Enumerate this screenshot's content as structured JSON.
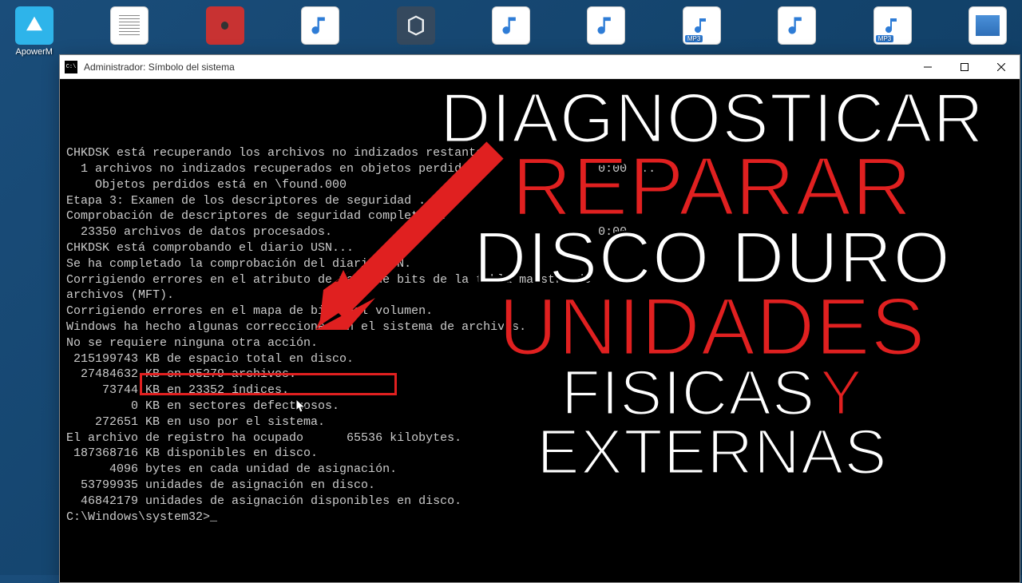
{
  "desktop": {
    "icons": [
      {
        "label": "ApowerM",
        "type": "app"
      },
      {
        "label": "",
        "type": "doc"
      },
      {
        "label": "",
        "type": "media"
      },
      {
        "label": "",
        "type": "audio"
      },
      {
        "label": "",
        "type": "vbox"
      },
      {
        "label": "",
        "type": "audio"
      },
      {
        "label": "",
        "type": "audio"
      },
      {
        "label": "MP3",
        "type": "mp3"
      },
      {
        "label": "",
        "type": "audio"
      },
      {
        "label": "MP3",
        "type": "mp3"
      },
      {
        "label": "",
        "type": "video"
      }
    ]
  },
  "window": {
    "title": "Administrador: Símbolo del sistema"
  },
  "terminal": {
    "lines": [
      "CHKDSK está recuperando los archivos no indizados restantes.",
      "  1 archivos no indizados recuperados en objetos perdidos.                0:00 ...",
      "    Objetos perdidos está en \\found.000",
      "",
      "",
      "Etapa 3: Examen de los descriptores de seguridad ...",
      "Comprobación de descriptores de seguridad completada.",
      "  23350 archivos de datos procesados.                                     0:00",
      "CHKDSK está comprobando el diario USN...",
      "Se ha completado la comprobación del diario USN.",
      "Corrigiendo errores en el atributo de mapa de bits de la tabla maestra de",
      "archivos (MFT).",
      "Corrigiendo errores en el mapa de bits del volumen.",
      "",
      "Windows ha hecho algunas correcciones en el sistema de archivos.",
      "No se requiere ninguna otra acción.",
      "",
      " 215199743 KB de espacio total en disco.",
      "  27484632 KB en 95279 archivos.",
      "     73744 KB en 23352 índices.",
      "         0 KB en sectores defectuosos.",
      "    272651 KB en uso por el sistema.",
      "El archivo de registro ha ocupado      65536 kilobytes.",
      " 187368716 KB disponibles en disco.",
      "",
      "      4096 bytes en cada unidad de asignación.",
      "  53799935 unidades de asignación en disco.",
      "  46842179 unidades de asignación disponibles en disco.",
      "",
      "C:\\Windows\\system32>_"
    ]
  },
  "overlay": {
    "line1": "DIAGNOSTICAR",
    "line2": "REPARAR",
    "line3": "DISCO DURO",
    "line4": "UNIDADES",
    "line5a": "FISICAS",
    "line5b": "Y",
    "line5c": "EXTERNAS"
  }
}
